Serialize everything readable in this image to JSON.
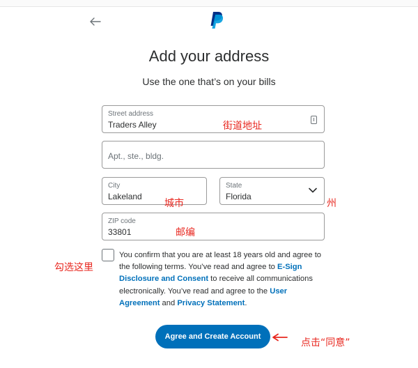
{
  "header": {
    "back_icon": "arrow-left-icon",
    "logo": "paypal-logo",
    "title": "Add your address",
    "subtitle": "Use the one that’s on your bills"
  },
  "form": {
    "street": {
      "label": "Street address",
      "value": "Traders Alley",
      "icon": "autofill-card-icon"
    },
    "apt": {
      "placeholder": "Apt., ste., bldg."
    },
    "city": {
      "label": "City",
      "value": "Lakeland"
    },
    "state": {
      "label": "State",
      "value": "Florida",
      "icon": "chevron-down-icon"
    },
    "zip": {
      "label": "ZIP code",
      "value": "33801"
    }
  },
  "terms": {
    "checked": false,
    "part1": "You confirm that you are at least 18 years old and agree to the following terms. You’ve read and agree to ",
    "link1": "E-Sign Disclosure and Consent",
    "part2": " to receive all communications electronically. You’ve read and agree to the ",
    "link2": "User Agreement",
    "part3": " and ",
    "link3": "Privacy Statement",
    "part4": "."
  },
  "actions": {
    "agree_label": "Agree and Create Account"
  },
  "annotations": {
    "street": "街道地址",
    "city": "城市",
    "state": "州",
    "zip": "邮编",
    "checkbox": "勾选这里",
    "agree": "点击“同意”"
  },
  "colors": {
    "brand_blue": "#0070ba",
    "annotation_red": "#e8271f"
  }
}
